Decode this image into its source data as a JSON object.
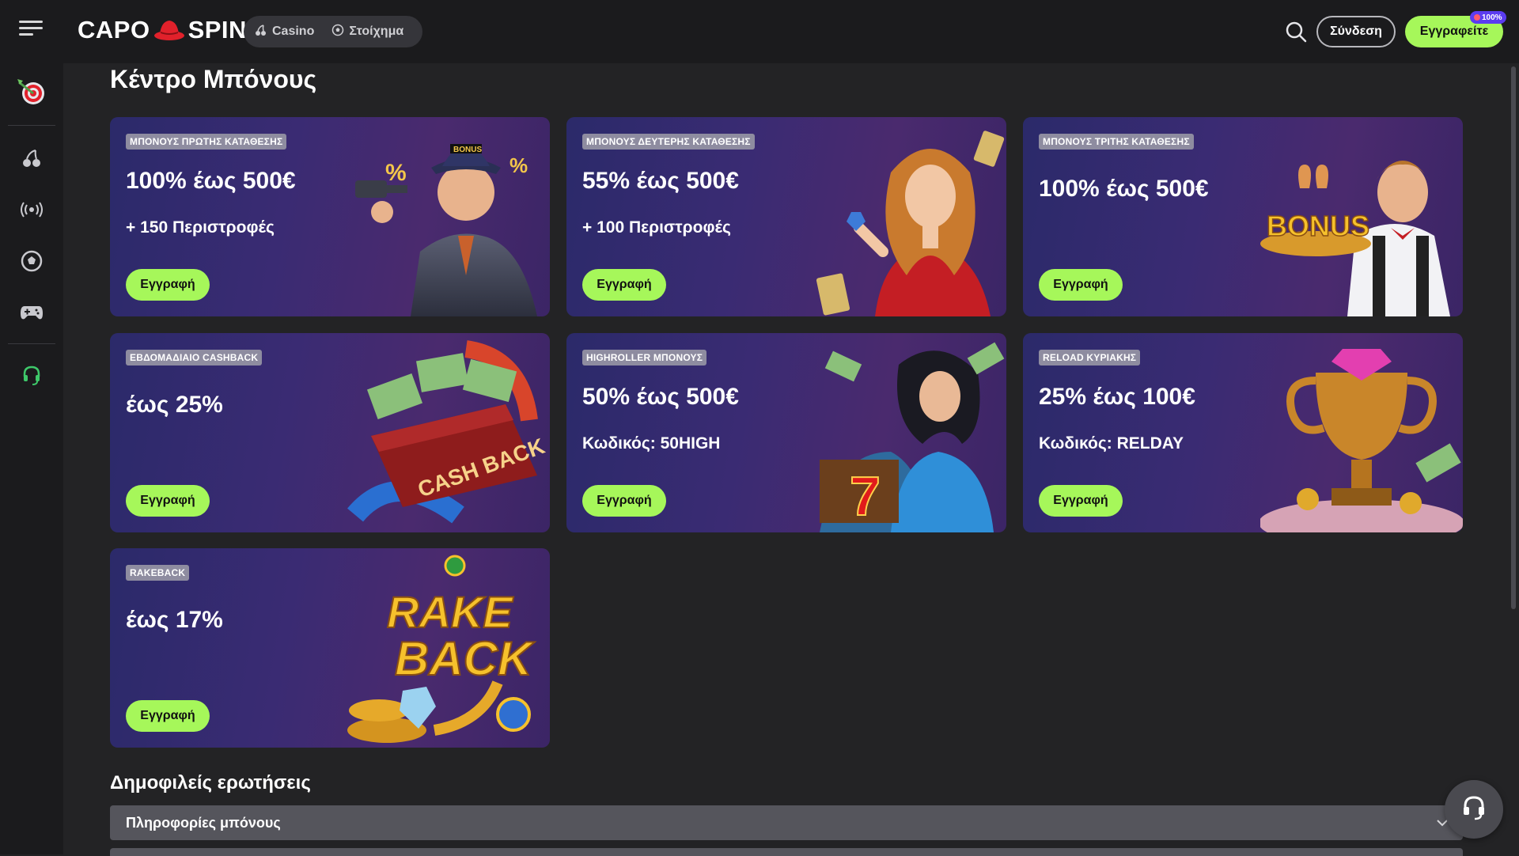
{
  "header": {
    "logo_left": "CAPO",
    "logo_right": "SPIN",
    "nav_tabs": [
      {
        "label": "Casino",
        "icon": "cherry-icon"
      },
      {
        "label": "Στοίχημα",
        "icon": "soccer-ball-icon"
      }
    ],
    "login_label": "Σύνδεση",
    "register_label": "Εγγραφείτε",
    "register_badge": "100%"
  },
  "sidebar": {
    "items": [
      {
        "icon": "target-icon"
      },
      {
        "icon": "cherry-icon"
      },
      {
        "icon": "live-broadcast-icon"
      },
      {
        "icon": "soccer-ball-icon"
      },
      {
        "icon": "gamepad-icon"
      },
      {
        "icon": "headset-icon"
      }
    ]
  },
  "page": {
    "title": "Κέντρο Μπόνους"
  },
  "cards": [
    {
      "tag": "ΜΠΟΝΟΥΣ ΠΡΩΤΗΣ ΚΑΤΑΘΕΣΗΣ",
      "headline": "100% έως 500€",
      "sub": "+ 150 Περιστροφές",
      "button": "Εγγραφή"
    },
    {
      "tag": "ΜΠΟΝΟΥΣ ΔΕΥΤΕΡΗΣ ΚΑΤΑΘΕΣΗΣ",
      "headline": "55% έως 500€",
      "sub": "+ 100 Περιστροφές",
      "button": "Εγγραφή"
    },
    {
      "tag": "ΜΠΟΝΟΥΣ ΤΡΙΤΗΣ ΚΑΤΑΘΕΣΗΣ",
      "headline": "100% έως 500€",
      "sub": "",
      "button": "Εγγραφή",
      "art_text": "BONUS"
    },
    {
      "tag": "ΕΒΔΟΜΑΔΙΑΙΟ CASHBACK",
      "headline": "έως 25%",
      "sub": "",
      "button": "Εγγραφή",
      "art_text": "CASH BACK"
    },
    {
      "tag": "HIGHROLLER ΜΠΟΝΟΥΣ",
      "headline": "50% έως 500€",
      "sub": "Κωδικός: 50HIGH",
      "button": "Εγγραφή"
    },
    {
      "tag": "RELOAD ΚΥΡΙΑΚΗΣ",
      "headline": "25% έως 100€",
      "sub": "Κωδικός: RELDAY",
      "button": "Εγγραφή"
    },
    {
      "tag": "RAKEBACK",
      "headline": "έως 17%",
      "sub": "",
      "button": "Εγγραφή",
      "art_text_1": "RAKE",
      "art_text_2": "BACK"
    }
  ],
  "faq": {
    "title": "Δημοφιλείς ερωτήσεις",
    "items": [
      "Πληροφορίες μπόνους"
    ]
  },
  "colors": {
    "accent": "#a6f75a",
    "background": "#232325",
    "header": "#1b1b1d",
    "tag": "#8e8ca0",
    "faq_row": "#55555c"
  }
}
